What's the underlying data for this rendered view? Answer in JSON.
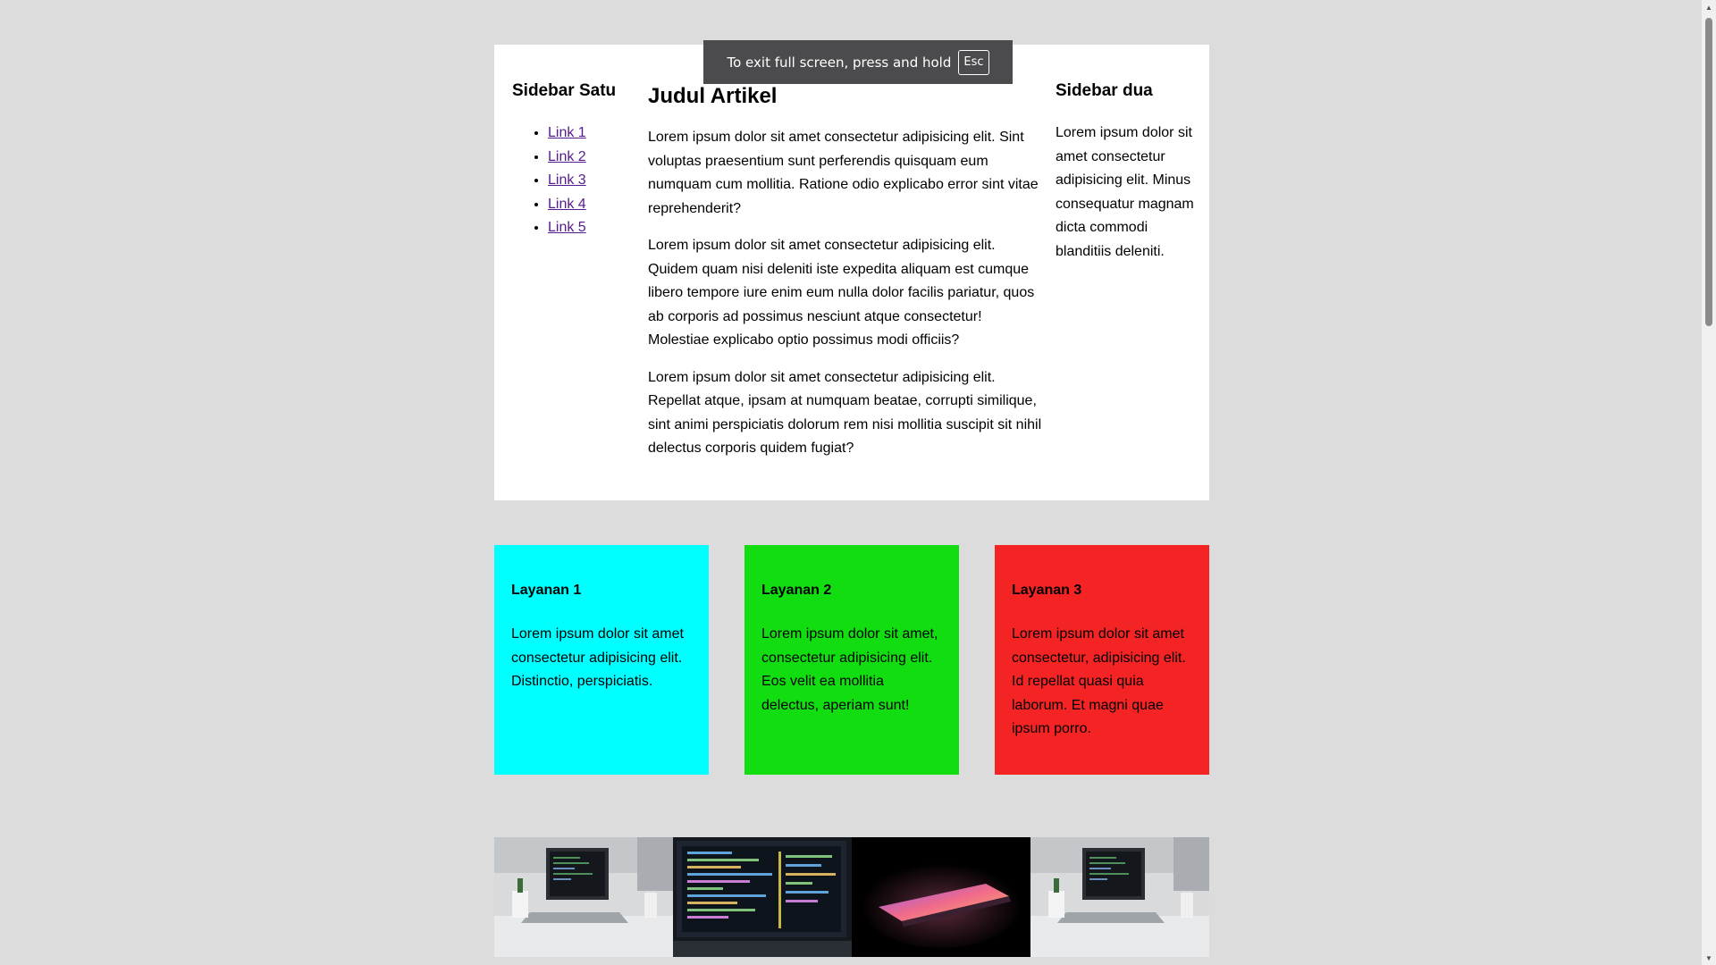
{
  "sidebar_one": {
    "title": "Sidebar Satu",
    "links": [
      "Link 1",
      "Link 2",
      "Link 3",
      "Link 4",
      "Link 5"
    ]
  },
  "article": {
    "title": "Judul Artikel",
    "paragraphs": [
      "Lorem ipsum dolor sit amet consectetur adipisicing elit. Sint voluptas praesentium sunt perferendis quisquam eum numquam cum mollitia. Ratione odio explicabo error sint vitae reprehenderit?",
      "Lorem ipsum dolor sit amet consectetur adipisicing elit. Quidem quam nisi deleniti iste expedita aliquam est cumque libero tempore iure enim eum nulla dolor facilis pariatur, quos ab corporis ad possimus nesciunt atque consectetur! Molestiae explicabo optio possimus modi officiis?",
      "Lorem ipsum dolor sit amet consectetur adipisicing elit. Repellat atque, ipsam at numquam beatae, corrupti similique, sint animi perspiciatis dolorum rem nisi mollitia suscipit sit nihil delectus corporis quidem fugiat?"
    ]
  },
  "sidebar_two": {
    "title": "Sidebar dua",
    "text": "Lorem ipsum dolor sit amet consectetur adipisicing elit. Minus consequatur magnam dicta commodi blanditiis deleniti."
  },
  "services": [
    {
      "title": "Layanan 1",
      "text": "Lorem ipsum dolor sit amet consectetur adipisicing elit. Distinctio, perspiciatis.",
      "color": "#00ffff"
    },
    {
      "title": "Layanan 2",
      "text": "Lorem ipsum dolor sit amet, consectetur adipisicing elit. Eos velit ea mollitia delectus, aperiam sunt!",
      "color": "#11dd11"
    },
    {
      "title": "Layanan 3",
      "text": "Lorem ipsum dolor sit amet consectetur, adipisicing elit. Id repellat quasi quia laborum. Et magni quae ipsum porro.",
      "color": "#f42424"
    }
  ],
  "gallery": [
    {
      "subject": "laptop-on-desk"
    },
    {
      "subject": "laptop-with-code"
    },
    {
      "subject": "glowing-laptop"
    },
    {
      "subject": "laptop-on-desk"
    }
  ],
  "fullscreen_notice": {
    "text": "To exit full screen, press and hold",
    "key": "Esc"
  }
}
